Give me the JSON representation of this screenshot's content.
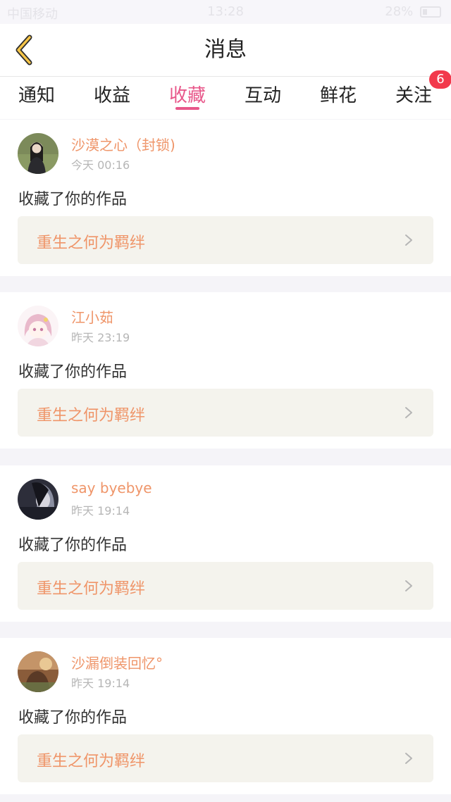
{
  "status_bar": {
    "carrier": "中国移动",
    "time": "13:28",
    "battery": "28%"
  },
  "header": {
    "title": "消息",
    "back_label": "返回"
  },
  "tabs": [
    {
      "label": "通知",
      "active": false
    },
    {
      "label": "收益",
      "active": false
    },
    {
      "label": "收藏",
      "active": true
    },
    {
      "label": "互动",
      "active": false
    },
    {
      "label": "鲜花",
      "active": false
    },
    {
      "label": "关注",
      "active": false,
      "badge": "6"
    }
  ],
  "colors": {
    "accent": "#e8578a",
    "username": "#ef9569",
    "badge": "#f2394c",
    "work_box_bg": "#f4f3ed"
  },
  "messages": [
    {
      "user": "沙漠之心（封锁)",
      "time": "今天 00:16",
      "action": "收藏了你的作品",
      "work_title": "重生之何为羁绊",
      "avatar_icon": "avatar-photo-girl-in-grass"
    },
    {
      "user": "江小茹",
      "time": "昨天 23:19",
      "action": "收藏了你的作品",
      "work_title": "重生之何为羁绊",
      "avatar_icon": "avatar-anime-girl"
    },
    {
      "user": "say byebye",
      "time": "昨天 19:14",
      "action": "收藏了你的作品",
      "work_title": "重生之何为羁绊",
      "avatar_icon": "avatar-dark-portrait"
    },
    {
      "user": "沙漏倒装回忆°",
      "time": "昨天 19:14",
      "action": "收藏了你的作品",
      "work_title": "重生之何为羁绊",
      "avatar_icon": "avatar-warm-photo"
    }
  ]
}
